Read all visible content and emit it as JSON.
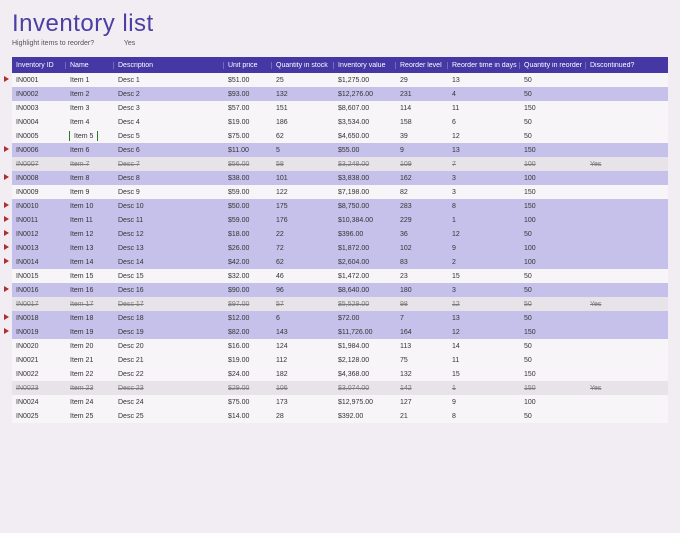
{
  "title": "Inventory list",
  "subhead_label": "Highlight items to reorder?",
  "subhead_value": "Yes",
  "columns": [
    "Inventory ID",
    "Name",
    "Description",
    "Unit price",
    "Quantity in stock",
    "Inventory value",
    "Reorder level",
    "Reorder time in days",
    "Quantity in reorder",
    "Discontinued?"
  ],
  "selected": {
    "row": 4,
    "col": 1
  },
  "rows": [
    {
      "flag": true,
      "shade": false,
      "disc": false,
      "cells": [
        "IN0001",
        "Item 1",
        "Desc 1",
        "$51.00",
        "25",
        "$1,275.00",
        "29",
        "13",
        "50",
        ""
      ]
    },
    {
      "flag": false,
      "shade": true,
      "disc": false,
      "cells": [
        "IN0002",
        "Item 2",
        "Desc 2",
        "$93.00",
        "132",
        "$12,276.00",
        "231",
        "4",
        "50",
        ""
      ]
    },
    {
      "flag": false,
      "shade": false,
      "disc": false,
      "cells": [
        "IN0003",
        "Item 3",
        "Desc 3",
        "$57.00",
        "151",
        "$8,607.00",
        "114",
        "11",
        "150",
        ""
      ]
    },
    {
      "flag": false,
      "shade": false,
      "disc": false,
      "cells": [
        "IN0004",
        "Item 4",
        "Desc 4",
        "$19.00",
        "186",
        "$3,534.00",
        "158",
        "6",
        "50",
        ""
      ]
    },
    {
      "flag": false,
      "shade": false,
      "disc": false,
      "cells": [
        "IN0005",
        "Item 5",
        "Desc 5",
        "$75.00",
        "62",
        "$4,650.00",
        "39",
        "12",
        "50",
        ""
      ]
    },
    {
      "flag": true,
      "shade": true,
      "disc": false,
      "cells": [
        "IN0006",
        "Item 6",
        "Desc 6",
        "$11.00",
        "5",
        "$55.00",
        "9",
        "13",
        "150",
        ""
      ]
    },
    {
      "flag": false,
      "shade": false,
      "disc": true,
      "cells": [
        "IN0007",
        "Item 7",
        "Desc 7",
        "$56.00",
        "58",
        "$3,248.00",
        "109",
        "7",
        "100",
        "Yes"
      ]
    },
    {
      "flag": true,
      "shade": true,
      "disc": false,
      "cells": [
        "IN0008",
        "Item 8",
        "Desc 8",
        "$38.00",
        "101",
        "$3,838.00",
        "162",
        "3",
        "100",
        ""
      ]
    },
    {
      "flag": false,
      "shade": false,
      "disc": false,
      "cells": [
        "IN0009",
        "Item 9",
        "Desc 9",
        "$59.00",
        "122",
        "$7,198.00",
        "82",
        "3",
        "150",
        ""
      ]
    },
    {
      "flag": true,
      "shade": true,
      "disc": false,
      "cells": [
        "IN0010",
        "Item 10",
        "Desc 10",
        "$50.00",
        "175",
        "$8,750.00",
        "283",
        "8",
        "150",
        ""
      ]
    },
    {
      "flag": true,
      "shade": true,
      "disc": false,
      "cells": [
        "IN0011",
        "Item 11",
        "Desc 11",
        "$59.00",
        "176",
        "$10,384.00",
        "229",
        "1",
        "100",
        ""
      ]
    },
    {
      "flag": true,
      "shade": true,
      "disc": false,
      "cells": [
        "IN0012",
        "Item 12",
        "Desc 12",
        "$18.00",
        "22",
        "$396.00",
        "36",
        "12",
        "50",
        ""
      ]
    },
    {
      "flag": true,
      "shade": true,
      "disc": false,
      "cells": [
        "IN0013",
        "Item 13",
        "Desc 13",
        "$26.00",
        "72",
        "$1,872.00",
        "102",
        "9",
        "100",
        ""
      ]
    },
    {
      "flag": true,
      "shade": true,
      "disc": false,
      "cells": [
        "IN0014",
        "Item 14",
        "Desc 14",
        "$42.00",
        "62",
        "$2,604.00",
        "83",
        "2",
        "100",
        ""
      ]
    },
    {
      "flag": false,
      "shade": false,
      "disc": false,
      "cells": [
        "IN0015",
        "Item 15",
        "Desc 15",
        "$32.00",
        "46",
        "$1,472.00",
        "23",
        "15",
        "50",
        ""
      ]
    },
    {
      "flag": true,
      "shade": true,
      "disc": false,
      "cells": [
        "IN0016",
        "Item 16",
        "Desc 16",
        "$90.00",
        "96",
        "$8,640.00",
        "180",
        "3",
        "50",
        ""
      ]
    },
    {
      "flag": false,
      "shade": false,
      "disc": true,
      "cells": [
        "IN0017",
        "Item 17",
        "Desc 17",
        "$97.00",
        "57",
        "$5,529.00",
        "98",
        "12",
        "50",
        "Yes"
      ]
    },
    {
      "flag": true,
      "shade": true,
      "disc": false,
      "cells": [
        "IN0018",
        "Item 18",
        "Desc 18",
        "$12.00",
        "6",
        "$72.00",
        "7",
        "13",
        "50",
        ""
      ]
    },
    {
      "flag": true,
      "shade": true,
      "disc": false,
      "cells": [
        "IN0019",
        "Item 19",
        "Desc 19",
        "$82.00",
        "143",
        "$11,726.00",
        "164",
        "12",
        "150",
        ""
      ]
    },
    {
      "flag": false,
      "shade": false,
      "disc": false,
      "cells": [
        "IN0020",
        "Item 20",
        "Desc 20",
        "$16.00",
        "124",
        "$1,984.00",
        "113",
        "14",
        "50",
        ""
      ]
    },
    {
      "flag": false,
      "shade": false,
      "disc": false,
      "cells": [
        "IN0021",
        "Item 21",
        "Desc 21",
        "$19.00",
        "112",
        "$2,128.00",
        "75",
        "11",
        "50",
        ""
      ]
    },
    {
      "flag": false,
      "shade": false,
      "disc": false,
      "cells": [
        "IN0022",
        "Item 22",
        "Desc 22",
        "$24.00",
        "182",
        "$4,368.00",
        "132",
        "15",
        "150",
        ""
      ]
    },
    {
      "flag": false,
      "shade": false,
      "disc": true,
      "cells": [
        "IN0023",
        "Item 23",
        "Desc 23",
        "$29.00",
        "106",
        "$3,074.00",
        "142",
        "1",
        "150",
        "Yes"
      ]
    },
    {
      "flag": false,
      "shade": false,
      "disc": false,
      "cells": [
        "IN0024",
        "Item 24",
        "Desc 24",
        "$75.00",
        "173",
        "$12,975.00",
        "127",
        "9",
        "100",
        ""
      ]
    },
    {
      "flag": false,
      "shade": false,
      "disc": false,
      "cells": [
        "IN0025",
        "Item 25",
        "Desc 25",
        "$14.00",
        "28",
        "$392.00",
        "21",
        "8",
        "50",
        ""
      ]
    }
  ]
}
